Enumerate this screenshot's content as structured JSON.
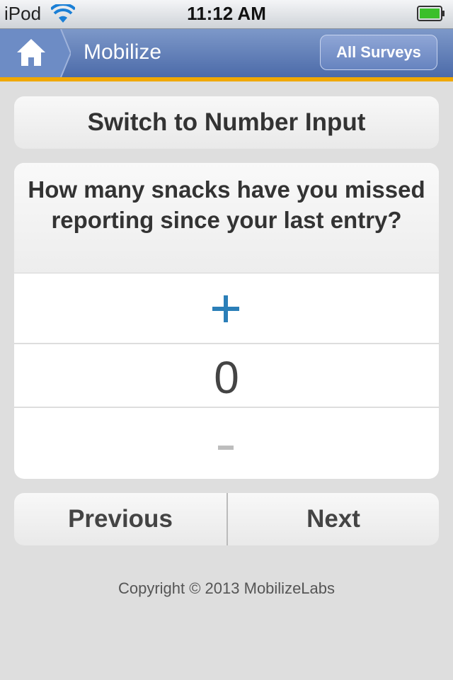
{
  "status_bar": {
    "device": "iPod",
    "time": "11:12 AM"
  },
  "header": {
    "title": "Mobilize",
    "all_surveys_label": "All Surveys"
  },
  "switch_button_label": "Switch to Number Input",
  "question": {
    "text": "How many snacks have you missed reporting since your last entry?",
    "value": "0"
  },
  "navigation": {
    "previous_label": "Previous",
    "next_label": "Next"
  },
  "footer": {
    "copyright": "Copyright © 2013 MobilizeLabs"
  },
  "colors": {
    "header_blue": "#5a78b4",
    "header_accent": "#f0a800",
    "plus_blue": "#2b7fb8",
    "minus_gray": "#bdbdbd"
  }
}
